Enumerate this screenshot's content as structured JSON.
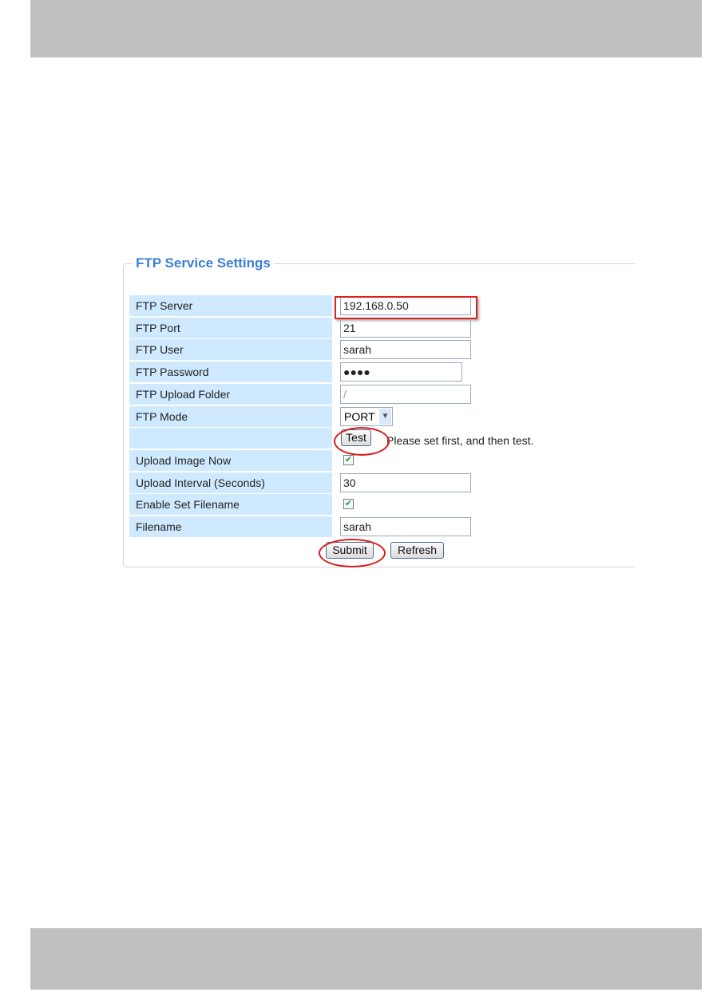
{
  "title": "FTP Service Settings",
  "fields": [
    {
      "label": "FTP Server",
      "value": "192.168.0.50",
      "type": "text"
    },
    {
      "label": "FTP Port",
      "value": "21",
      "type": "text"
    },
    {
      "label": "FTP User",
      "value": "sarah",
      "type": "text"
    },
    {
      "label": "FTP Password",
      "value": "●●●●",
      "type": "password"
    },
    {
      "label": "FTP Upload Folder",
      "value": "/",
      "type": "text"
    },
    {
      "label": "FTP Mode",
      "value": "PORT",
      "type": "select"
    },
    {
      "label": "",
      "type": "test"
    },
    {
      "label": "Upload Image Now",
      "checked": true,
      "type": "checkbox"
    },
    {
      "label": "Upload Interval (Seconds)",
      "value": "30",
      "type": "text"
    },
    {
      "label": "Enable Set Filename",
      "checked": true,
      "type": "checkbox"
    },
    {
      "label": "Filename",
      "value": "sarah",
      "type": "text"
    }
  ],
  "test_label": "Test",
  "test_message": "Please set first, and then test.",
  "submit_label": "Submit",
  "refresh_label": "Refresh",
  "check_mark": "✔",
  "select_arrow": "▼",
  "colors": {
    "accent": "#3a7fd6",
    "label_bg": "#cfeaff",
    "highlight": "#e02020"
  }
}
